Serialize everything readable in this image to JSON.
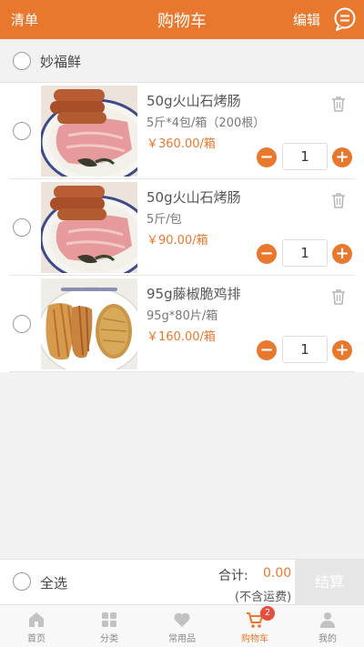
{
  "header": {
    "left": "清单",
    "title": "购物车",
    "edit": "编辑"
  },
  "shop": {
    "name": "妙福鲜"
  },
  "items": [
    {
      "name": "50g火山石烤肠",
      "spec": "5斤*4包/箱（200根）",
      "price": "￥360.00/箱",
      "qty": "1",
      "image": "sausage-photo"
    },
    {
      "name": "50g火山石烤肠",
      "spec": "5斤/包",
      "price": "￥90.00/箱",
      "qty": "1",
      "image": "sausage-photo"
    },
    {
      "name": "95g藤椒脆鸡排",
      "spec": "95g*80片/箱",
      "price": "￥160.00/箱",
      "qty": "1",
      "image": "chicken-cutlet-photo"
    }
  ],
  "footer": {
    "select_all": "全选",
    "total_label": "合计:",
    "total_value": "0.00",
    "shipping_note": "(不含运费)",
    "checkout": "结算"
  },
  "tabs": [
    {
      "label": "首页",
      "icon": "home-icon"
    },
    {
      "label": "分类",
      "icon": "category-icon"
    },
    {
      "label": "常用品",
      "icon": "heart-icon"
    },
    {
      "label": "购物车",
      "icon": "cart-icon",
      "badge": "2",
      "active": true
    },
    {
      "label": "我的",
      "icon": "user-icon"
    }
  ],
  "colors": {
    "accent": "#e8782e",
    "badge": "#e54d3c"
  }
}
